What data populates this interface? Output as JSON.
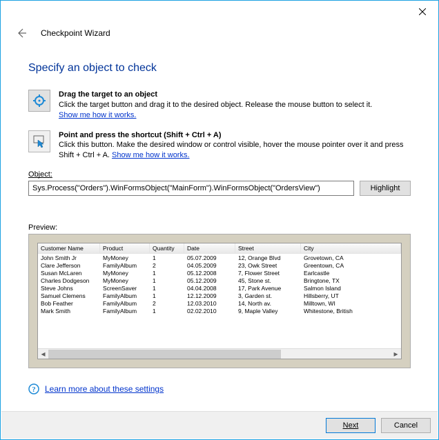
{
  "window": {
    "title": "Checkpoint Wizard"
  },
  "page_title": "Specify an object to check",
  "drag": {
    "heading": "Drag the target to an object",
    "desc": "Click the target button and drag it to the desired object. Release the mouse button to select it.",
    "link": "Show me how it works."
  },
  "shortcut": {
    "heading": "Point and press the shortcut (Shift + Ctrl + A)",
    "desc_a": "Click this button. Make the desired window or control visible, hover the mouse pointer over it and press Shift + Ctrl + A. ",
    "link": "Show me how it works."
  },
  "object_label": "Object:",
  "object_value": "Sys.Process(\"Orders\").WinFormsObject(\"MainForm\").WinFormsObject(\"OrdersView\")",
  "highlight": "Highlight",
  "preview_label": "Preview:",
  "grid": {
    "headers": [
      "Customer Name",
      "Product",
      "Quantity",
      "Date",
      "Street",
      "City"
    ],
    "rows": [
      [
        "John Smith Jr",
        "MyMoney",
        "1",
        "05.07.2009",
        "12, Orange Blvd",
        "Grovetown, CA"
      ],
      [
        "Clare Jefferson",
        "FamilyAlbum",
        "2",
        "04.05.2009",
        "23, Owk Street",
        "Greentown, CA"
      ],
      [
        "Susan McLaren",
        "MyMoney",
        "1",
        "05.12.2008",
        "7, Flower Street",
        "Earlcastle"
      ],
      [
        "Charles Dodgeson",
        "MyMoney",
        "1",
        "05.12.2009",
        "45, Stone st.",
        "Bringtone, TX"
      ],
      [
        "Steve Johns",
        "ScreenSaver",
        "1",
        "04.04.2008",
        "17, Park Avenue",
        "Salmon Island"
      ],
      [
        "Samuel Clemens",
        "FamilyAlbum",
        "1",
        "12.12.2009",
        "3, Garden st.",
        "Hillsberry, UT"
      ],
      [
        "Bob Feather",
        "FamilyAlbum",
        "2",
        "12.03.2010",
        "14, North av.",
        "Milltown, WI"
      ],
      [
        "Mark Smith",
        "FamilyAlbum",
        "1",
        "02.02.2010",
        "9, Maple Valley",
        "Whitestone, British"
      ]
    ]
  },
  "learn_more": "Learn more about these settings",
  "buttons": {
    "next": "Next",
    "cancel": "Cancel"
  }
}
